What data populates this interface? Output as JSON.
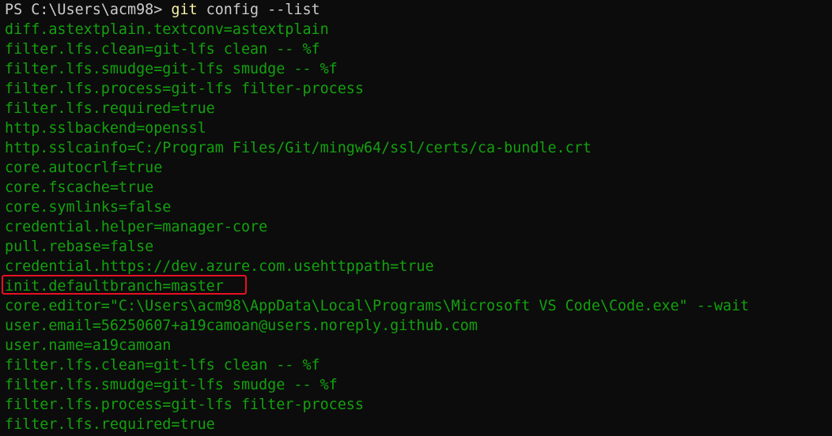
{
  "prompt": {
    "text": "PS C:\\Users\\acm98> ",
    "command": "git",
    "args": " config --list"
  },
  "output_lines": [
    "diff.astextplain.textconv=astextplain",
    "filter.lfs.clean=git-lfs clean -- %f",
    "filter.lfs.smudge=git-lfs smudge -- %f",
    "filter.lfs.process=git-lfs filter-process",
    "filter.lfs.required=true",
    "http.sslbackend=openssl",
    "http.sslcainfo=C:/Program Files/Git/mingw64/ssl/certs/ca-bundle.crt",
    "core.autocrlf=true",
    "core.fscache=true",
    "core.symlinks=false",
    "credential.helper=manager-core",
    "pull.rebase=false",
    "credential.https://dev.azure.com.usehttppath=true",
    "init.defaultbranch=master",
    "core.editor=\"C:\\Users\\acm98\\AppData\\Local\\Programs\\Microsoft VS Code\\Code.exe\" --wait",
    "user.email=56250607+a19camoan@users.noreply.github.com",
    "user.name=a19camoan",
    "filter.lfs.clean=git-lfs clean -- %f",
    "filter.lfs.smudge=git-lfs smudge -- %f",
    "filter.lfs.process=git-lfs filter-process",
    "filter.lfs.required=true"
  ],
  "colors": {
    "background": "#0c0c0c",
    "output_text": "#13a10e",
    "prompt_text": "#cccccc",
    "command_text": "#f9f1a5",
    "highlight_border": "#e81123"
  }
}
